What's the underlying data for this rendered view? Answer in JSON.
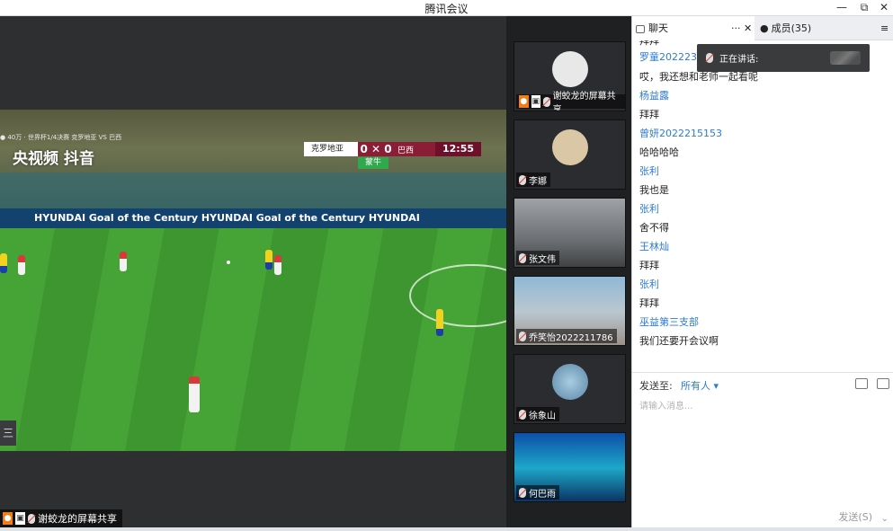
{
  "window": {
    "title": "腾讯会议",
    "minimize": "—",
    "restore": "⧉",
    "close": "✕"
  },
  "share": {
    "watermark": "央视频 抖音",
    "meta": "● 40万 · 世界杯1/4决赛 克罗地亚 VS 巴西",
    "board_text": "HYUNDAI   Goal of the Century   HYUNDAI   Goal of the Century   HYUNDAI",
    "team1": "克罗地亚",
    "team2": "巴西",
    "score": "0 ✕ 0",
    "clock": "12:55",
    "sub_badge": "蒙牛",
    "left_tab": "三",
    "presenter_label": "谢蛟龙的屏幕共享"
  },
  "participants": [
    {
      "name": "谢蛟龙的屏幕共享"
    },
    {
      "name": "李娜"
    },
    {
      "name": "张文伟"
    },
    {
      "name": "乔笑怡2022211786"
    },
    {
      "name": "徐象山"
    },
    {
      "name": "何巴雨"
    }
  ],
  "chat": {
    "tab_chat": "聊天",
    "tab_more": "···",
    "tab_close": "✕",
    "tab_members": "成员(35)",
    "tab_menu": "≡",
    "speaking_label": "正在讲话:",
    "messages": [
      {
        "kind": "text",
        "value": "拜拜"
      },
      {
        "kind": "sender",
        "value": "罗童2022235"
      },
      {
        "kind": "text",
        "value": "哎，我还想和老师一起看呢"
      },
      {
        "kind": "sender",
        "value": "杨益露"
      },
      {
        "kind": "text",
        "value": "拜拜"
      },
      {
        "kind": "sender",
        "value": "曾妍2022215153"
      },
      {
        "kind": "text",
        "value": "哈哈哈哈"
      },
      {
        "kind": "sender",
        "value": "张利"
      },
      {
        "kind": "text",
        "value": "我也是"
      },
      {
        "kind": "sender",
        "value": "张利"
      },
      {
        "kind": "text",
        "value": "舍不得"
      },
      {
        "kind": "sender",
        "value": "王林灿"
      },
      {
        "kind": "text",
        "value": "拜拜"
      },
      {
        "kind": "sender",
        "value": "张利"
      },
      {
        "kind": "text",
        "value": "拜拜"
      },
      {
        "kind": "sender",
        "value": "巫益第三支部"
      },
      {
        "kind": "text",
        "value": "我们还要开会议啊"
      }
    ],
    "send_to_label": "发送至:",
    "send_to_value": "所有人 ▾",
    "placeholder": "请输入消息...",
    "send_button": "发送(S)",
    "send_dropdown": "⌄"
  }
}
